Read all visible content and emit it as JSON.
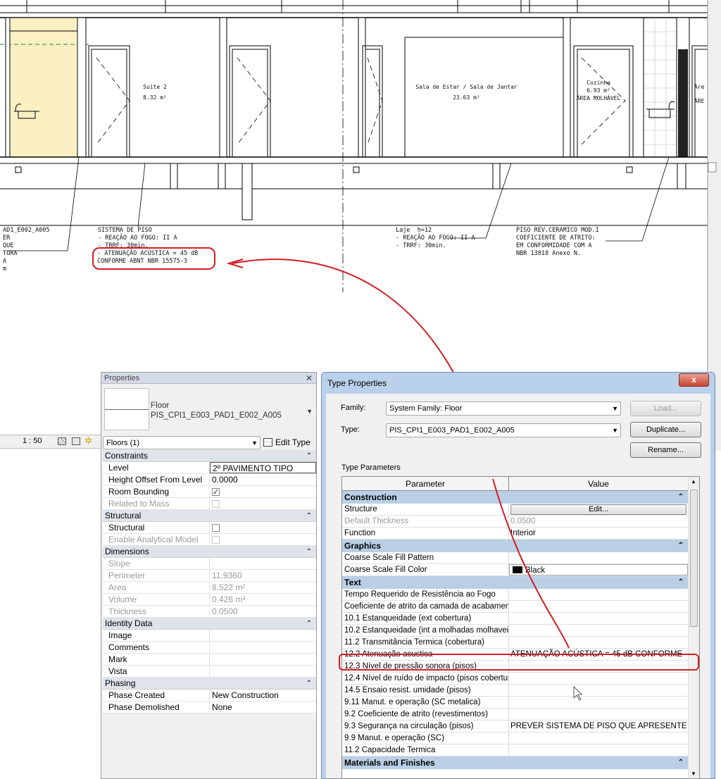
{
  "drawing": {
    "rooms": [
      {
        "name": "Suíte 2",
        "area": "8.32 m²"
      },
      {
        "name": "Sala de Estar / Sala de Jantar",
        "area": "23.63 m²"
      },
      {
        "name": "Cozinha",
        "area": "6.93 m²",
        "note": "ÁREA MOLHÁVEL"
      },
      {
        "name": "Áre",
        "note": "ÁRE"
      }
    ],
    "tag_left_lines": "AD1_E002_A005\nER\nQUE\nTURA\nA\nm",
    "tag_floor_system": "SISTEMA DE PISO\n- REAÇÃO AO FOGO: II A\n- TRRF: 30min.",
    "tag_floor_attenuation": "- ATENUAÇÃO ACÚSTICA = 45 dB\nCONFORME ABNT NBR 15575-3",
    "tag_slab": "Laje  h=12\n- REAÇÃO AO FOGO: II A\n- TRRF: 30min.",
    "tag_ceramic": "PISO REV.CERAMICO MOD.I\nCOEFICIENTE DE ATRITO:\nEM CONFORMIDADE COM A\nNBR 13818 Anexo N.",
    "scale": "1 : 50",
    "accent_red": "#d21d24"
  },
  "properties": {
    "title": "Properties",
    "family_label": "Floor",
    "type_name": "PIS_CPI1_E003_PAD1_E002_A005",
    "selector": "Floors (1)",
    "edit_type": "Edit Type",
    "groups": {
      "constraints": "Constraints",
      "structural": "Structural",
      "dimensions": "Dimensions",
      "identity": "Identity Data",
      "phasing": "Phasing"
    },
    "rows": {
      "level": {
        "k": "Level",
        "v": "2º PAVIMENTO TIPO"
      },
      "height_offset": {
        "k": "Height Offset From Level",
        "v": "0.0000"
      },
      "room_bounding": {
        "k": "Room Bounding"
      },
      "related_mass": {
        "k": "Related to Mass"
      },
      "structural": {
        "k": "Structural"
      },
      "analytical": {
        "k": "Enable Analytical Model"
      },
      "slope": {
        "k": "Slope",
        "v": ""
      },
      "perimeter": {
        "k": "Perimeter",
        "v": "11.9360"
      },
      "area": {
        "k": "Area",
        "v": "8.522 m²"
      },
      "volume": {
        "k": "Volume",
        "v": "0.426 m³"
      },
      "thickness": {
        "k": "Thickness",
        "v": "0.0500"
      },
      "image": {
        "k": "Image",
        "v": ""
      },
      "comments": {
        "k": "Comments",
        "v": ""
      },
      "mark": {
        "k": "Mark",
        "v": ""
      },
      "vista": {
        "k": "Vista",
        "v": ""
      },
      "phase_created": {
        "k": "Phase Created",
        "v": "New Construction"
      },
      "phase_demolished": {
        "k": "Phase Demolished",
        "v": "None"
      }
    }
  },
  "type_properties": {
    "title": "Type Properties",
    "close": "x",
    "family_label": "Family:",
    "family_value": "System Family: Floor",
    "type_label": "Type:",
    "type_value": "PIS_CPI1_E003_PAD1_E002_A005",
    "load": "Load...",
    "duplicate": "Duplicate...",
    "rename": "Rename...",
    "section_label": "Type Parameters",
    "col_param": "Parameter",
    "col_value": "Value",
    "groups": {
      "construction": "Construction",
      "graphics": "Graphics",
      "text": "Text",
      "materials": "Materials and Finishes"
    },
    "rows": {
      "structure": {
        "k": "Structure",
        "v": "Edit..."
      },
      "default_thickness": {
        "k": "Default Thickness",
        "v": "0.0500"
      },
      "function": {
        "k": "Function",
        "v": "Interior"
      },
      "coarse_pattern": {
        "k": "Coarse Scale Fill Pattern",
        "v": ""
      },
      "coarse_color": {
        "k": "Coarse Scale Fill Color",
        "v": "Black"
      },
      "t1": {
        "k": "Tempo Requerido de Resistência ao Fogo",
        "v": ""
      },
      "t2": {
        "k": "Coeficiente de atrito da camada de acabament",
        "v": ""
      },
      "t3": {
        "k": "10.1 Estanqueidade (ext cobertura)",
        "v": ""
      },
      "t4": {
        "k": "10.2 Estanqueidade (int a molhadas molhaveis",
        "v": ""
      },
      "t5": {
        "k": "11.2 Transmitância Termica (cobertura)",
        "v": ""
      },
      "t6": {
        "k": "12.2 Atenuação acustica",
        "v": "ATENUAÇÃO ACÚSTICA = 45 dB CONFORME"
      },
      "t7": {
        "k": "12.3 Nível de pressão sonora (pisos)",
        "v": ""
      },
      "t8": {
        "k": "12.4 Nível de ruído de impacto (pisos cobertur",
        "v": ""
      },
      "t9": {
        "k": "14.5 Ensaio resist. umidade (pisos)",
        "v": ""
      },
      "t10": {
        "k": "9.11 Manut. e operação (SC metalica)",
        "v": ""
      },
      "t11": {
        "k": "9.2 Coeficiente de atrito (revestimentos)",
        "v": ""
      },
      "t12": {
        "k": "9.3 Segurança na circulação (pisos)",
        "v": "PREVER SISTEMA DE PISO QUE APRESENTE AB"
      },
      "t13": {
        "k": "9.9 Manut. e operação (SC)",
        "v": ""
      },
      "t14": {
        "k": "11.2 Capacidade Termica",
        "v": ""
      }
    }
  }
}
